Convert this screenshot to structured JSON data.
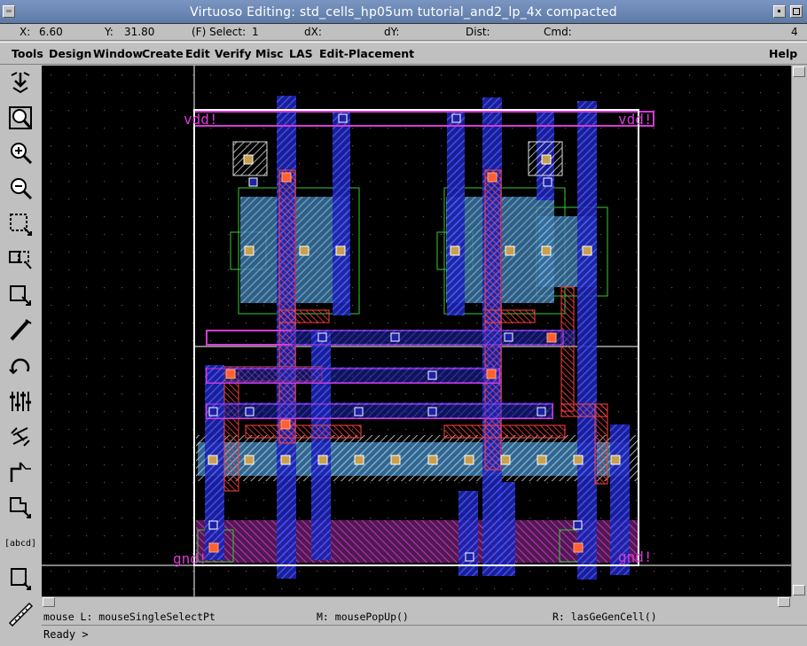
{
  "window": {
    "title": "Virtuoso Editing: std_cells_hp05um tutorial_and2_lp_4x compacted"
  },
  "status": {
    "x_label": "X:",
    "x_value": "6.60",
    "y_label": "Y:",
    "y_value": "31.80",
    "select_label": "(F) Select:",
    "select_value": "1",
    "dx_label": "dX:",
    "dy_label": "dY:",
    "dist_label": "Dist:",
    "cmd_label": "Cmd:",
    "window_number": "4"
  },
  "menu": {
    "items": [
      "Tools",
      "Design",
      "Window",
      "Create",
      "Edit",
      "Verify",
      "Misc",
      "LAS",
      "Edit-Placement"
    ],
    "help": "Help"
  },
  "toolbar": {
    "icons": [
      "save-icon",
      "zoom-fit-icon",
      "zoom-in-icon",
      "zoom-out-icon",
      "stretch-icon",
      "copy-icon",
      "move-icon",
      "path-icon",
      "undo-icon",
      "property-icon",
      "ruler-icon",
      "polygon-icon",
      "select-icon",
      "label-icon",
      "rectangle-icon",
      "ruler-diagonal-icon"
    ],
    "label_icon_text": "[abcd]"
  },
  "layout": {
    "vdd_left": "vdd!",
    "vdd_right": "vdd!",
    "gnd_left": "gnd!",
    "gnd_right": "gnd!",
    "colors": {
      "poly": "#ff3b3b",
      "metal1": "#3a44ff",
      "metal2": "#d63ad6",
      "active": "#33cc33",
      "well": "#6fb8e8",
      "select": "#ffffff",
      "boundary": "#ffffff"
    }
  },
  "mouse": {
    "left": "mouse L: mouseSingleSelectPt",
    "middle": "M: mousePopUp()",
    "right": "R: lasGeGenCell()"
  },
  "command": {
    "prompt": "Ready >"
  }
}
